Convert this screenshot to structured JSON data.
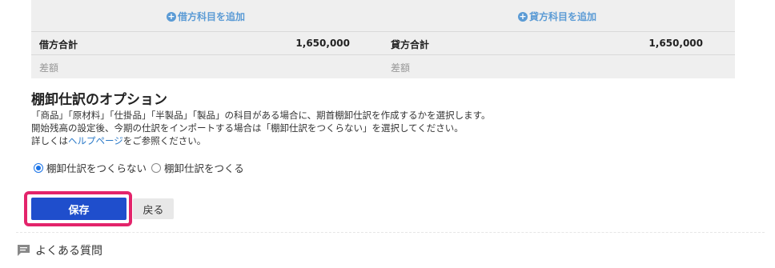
{
  "summary": {
    "add_debit": "借方科目を追加",
    "add_credit": "貸方科目を追加",
    "total_row": {
      "debit_label": "借方合計",
      "debit_value": "1,650,000",
      "credit_label": "貸方合計",
      "credit_value": "1,650,000"
    },
    "diff_row": {
      "debit_label": "差額",
      "credit_label": "差額"
    }
  },
  "options": {
    "title": "棚卸仕訳のオプション",
    "desc1": "「商品」「原材料」「仕掛品」「半製品」「製品」の科目がある場合に、期首棚卸仕訳を作成するかを選択します。",
    "desc2": "開始残高の設定後、今期の仕訳をインポートする場合は「棚卸仕訳をつくらない」を選択してください。",
    "desc3_prefix": "詳しくは",
    "desc3_link": "ヘルプページ",
    "desc3_suffix": "をご参照ください。",
    "radio_no": "棚卸仕訳をつくらない",
    "radio_yes": "棚卸仕訳をつくる",
    "selected": "棚卸仕訳をつくらない"
  },
  "actions": {
    "save": "保存",
    "back": "戻る"
  },
  "faq": {
    "label": "よくある質問"
  }
}
